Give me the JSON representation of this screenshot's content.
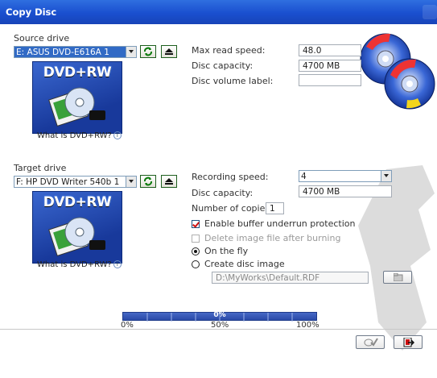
{
  "window": {
    "title": "Copy Disc"
  },
  "source": {
    "section_label": "Source drive",
    "drive_value": "E: ASUS   DVD-E616A    1",
    "media_logo": "DVD+RW",
    "what_is_link": "What is DVD+RW?",
    "max_read_speed_label": "Max read speed:",
    "max_read_speed_value": "48.0",
    "disc_capacity_label": "Disc capacity:",
    "disc_capacity_value": "4700 MB",
    "volume_label_label": "Disc volume label:",
    "volume_label_value": ""
  },
  "target": {
    "section_label": "Target drive",
    "drive_value": "F: HP    DVD Writer 540b 1",
    "media_logo": "DVD+RW",
    "what_is_link": "What is DVD+RW?",
    "recording_speed_label": "Recording speed:",
    "recording_speed_value": "4",
    "disc_capacity_label": "Disc capacity:",
    "disc_capacity_value": "4700 MB",
    "copies_label": "Number of copies:",
    "copies_value": "1",
    "buffer_label": "Enable buffer underrun protection",
    "buffer_checked": true,
    "delete_image_label": "Delete image file after burning",
    "delete_image_checked": false,
    "on_the_fly_label": "On the fly",
    "create_image_label": "Create disc image",
    "mode_selected": "on_the_fly",
    "image_path": "D:\\MyWorks\\Default.RDF"
  },
  "progress": {
    "value_pct": 0,
    "label": "0%",
    "ticks": [
      "0%",
      "50%",
      "100%"
    ]
  },
  "icons": {
    "refresh": "refresh-icon",
    "eject": "eject-icon",
    "info": "info-icon",
    "browse": "folder-browse-icon",
    "ok": "burn-ok-icon",
    "exit": "exit-icon"
  },
  "colors": {
    "titlebar": "#1a4fcf",
    "accent": "#316ac5",
    "progress": "#2a4aa8",
    "check": "#cc1111"
  }
}
